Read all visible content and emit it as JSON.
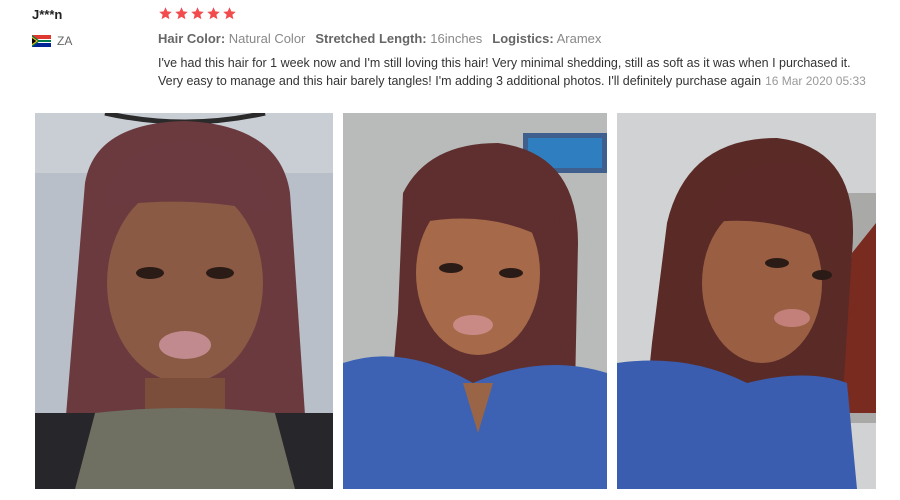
{
  "reviewer": {
    "name": "J***n",
    "country_code": "ZA",
    "flag_icon": "south-africa-flag-icon"
  },
  "rating": {
    "stars": 5,
    "max": 5,
    "star_color": "#f24c4c"
  },
  "attributes": [
    {
      "label": "Hair Color:",
      "value": "Natural Color"
    },
    {
      "label": "Stretched Length:",
      "value": "16inches"
    },
    {
      "label": "Logistics:",
      "value": "Aramex"
    }
  ],
  "review": {
    "text": "I've had this hair for 1 week now and I'm still loving this hair! Very minimal shedding, still as soft as it was when I purchased it. Very easy to manage and this hair barely tangles! I'm adding 3 additional photos. I'll definitely purchase again",
    "date": "16 Mar 2020 05:33"
  },
  "photos": [
    {
      "name": "review-photo-1"
    },
    {
      "name": "review-photo-2"
    },
    {
      "name": "review-photo-3"
    }
  ]
}
